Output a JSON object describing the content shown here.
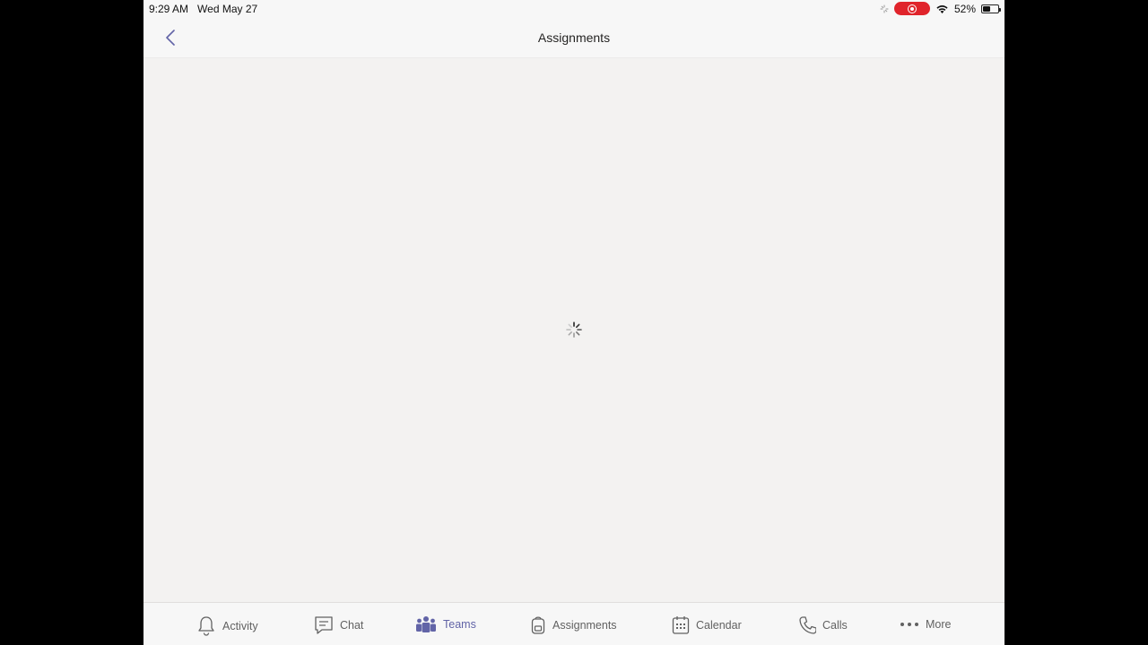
{
  "status_bar": {
    "time": "9:29 AM",
    "date": "Wed May 27",
    "battery_percent": "52%",
    "battery_level": 0.52,
    "recording_color": "#e0242b"
  },
  "header": {
    "title": "Assignments",
    "back_icon": "chevron-left-icon"
  },
  "content": {
    "state": "loading",
    "loader_icon": "spinner-icon"
  },
  "tabs": [
    {
      "label": "Activity",
      "icon": "bell-icon",
      "active": false
    },
    {
      "label": "Chat",
      "icon": "chat-icon",
      "active": false
    },
    {
      "label": "Teams",
      "icon": "teams-icon",
      "active": true
    },
    {
      "label": "Assignments",
      "icon": "backpack-icon",
      "active": false
    },
    {
      "label": "Calendar",
      "icon": "calendar-icon",
      "active": false
    },
    {
      "label": "Calls",
      "icon": "phone-icon",
      "active": false
    },
    {
      "label": "More",
      "icon": "more-icon",
      "active": false
    }
  ],
  "colors": {
    "accent": "#6264a7",
    "inactive_text": "#616161",
    "background": "#f3f2f1"
  }
}
